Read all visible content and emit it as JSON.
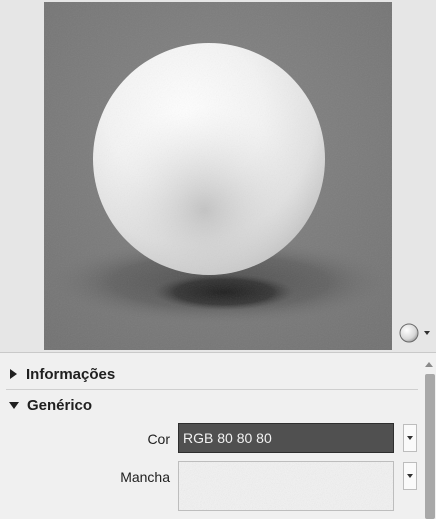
{
  "preview": {
    "background_color": "#7a7a7a",
    "sphere_color": "#f2f2f2",
    "shadow_color": "#3c3c3c",
    "type_icon": "sphere-icon",
    "dropdown_icon": "chevron-down-icon"
  },
  "sections": [
    {
      "label": "Informações",
      "expanded": false
    },
    {
      "label": "Genérico",
      "expanded": true
    }
  ],
  "properties": {
    "color": {
      "label": "Cor",
      "value": "RGB 80 80 80",
      "swatch": "#505050"
    },
    "texture": {
      "label": "Mancha"
    }
  }
}
